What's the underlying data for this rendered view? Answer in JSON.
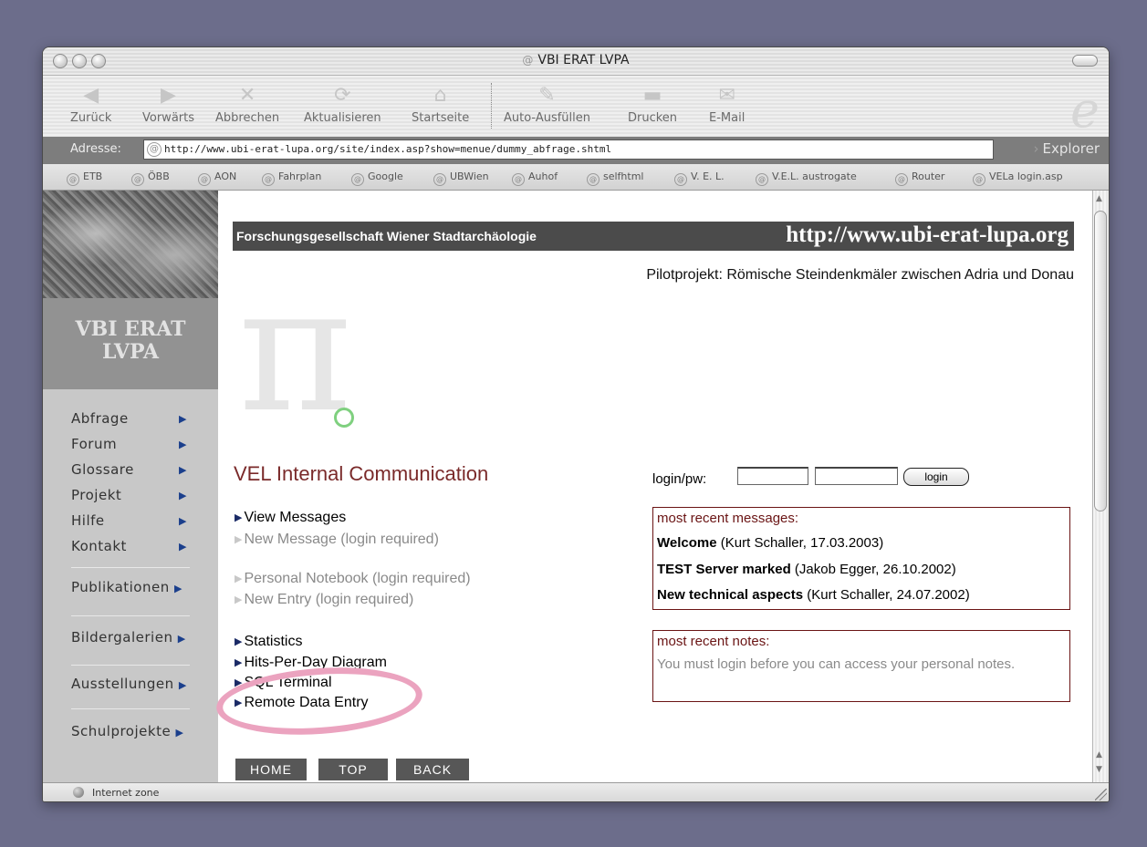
{
  "window": {
    "title": "VBI ERAT LVPA"
  },
  "toolbar": {
    "back": "Zurück",
    "forward": "Vorwärts",
    "stop": "Abbrechen",
    "refresh": "Aktualisieren",
    "home": "Startseite",
    "autofill": "Auto-Ausfüllen",
    "print": "Drucken",
    "mail": "E-Mail"
  },
  "address": {
    "label": "Adresse:",
    "url": "http://www.ubi-erat-lupa.org/site/index.asp?show=menue/dummy_abfrage.shtml",
    "explorer": "Explorer"
  },
  "favorites": [
    "ETB",
    "ÖBB",
    "AON",
    "Fahrplan",
    "Google",
    "UBWien",
    "Auhof",
    "selfhtml",
    "V. E. L.",
    "V.E.L. austrogate",
    "Router",
    "VELa login.asp"
  ],
  "sidebar": {
    "brand_line1": "VBI ERAT",
    "brand_line2": "LVPA",
    "items": [
      "Abfrage",
      "Forum",
      "Glossare",
      "Projekt",
      "Hilfe",
      "Kontakt"
    ],
    "sections": [
      "Publikationen",
      "Bildergalerien",
      "Ausstellungen",
      "Schulprojekte"
    ]
  },
  "header": {
    "org": "Forschungsgesellschaft Wiener Stadtarchäologie",
    "site": "http://www.ubi-erat-lupa.org",
    "pilot": "Pilotprojekt: Römische Steindenkmäler zwischen Adria und Donau"
  },
  "main": {
    "title": "VEL Internal Communication",
    "links": {
      "view_messages": "View Messages",
      "new_message": "New Message (login required)",
      "personal_notebook": "Personal Notebook (login required)",
      "new_entry": "New Entry (login required)",
      "statistics": "Statistics",
      "hits_per_day": "Hits-Per-Day Diagram",
      "sql_terminal": "SQL Terminal",
      "remote_data_entry": "Remote Data Entry"
    },
    "nav": {
      "home": "HOME",
      "top": "TOP",
      "back": "BACK"
    }
  },
  "login": {
    "label": "login/pw:",
    "user_value": "",
    "pw_value": "",
    "button": "login"
  },
  "messages": {
    "title": "most recent messages:",
    "items": [
      {
        "subject": "Welcome",
        "meta": "(Kurt Schaller, 17.03.2003)"
      },
      {
        "subject": "TEST Server marked",
        "meta": "(Jakob Egger, 26.10.2002)"
      },
      {
        "subject": "New technical aspects",
        "meta": "(Kurt Schaller, 24.07.2002)"
      }
    ]
  },
  "notes": {
    "title": "most recent notes:",
    "text": "You must login before you can access your personal notes."
  },
  "status": {
    "zone": "Internet zone"
  },
  "colors": {
    "desktop": "#6c6d8b",
    "header_band": "#4b4b4b",
    "title_accent": "#7a2a2a",
    "box_border": "#6a1414",
    "link_arrow": "#1a2a66",
    "highlight": "#eba3bf"
  },
  "icons": {
    "back": "left-arrow-icon",
    "forward": "right-arrow-icon",
    "stop": "x-icon",
    "refresh": "refresh-icon",
    "home": "house-icon",
    "autofill": "pen-icon",
    "print": "printer-icon",
    "mail": "envelope-icon"
  }
}
